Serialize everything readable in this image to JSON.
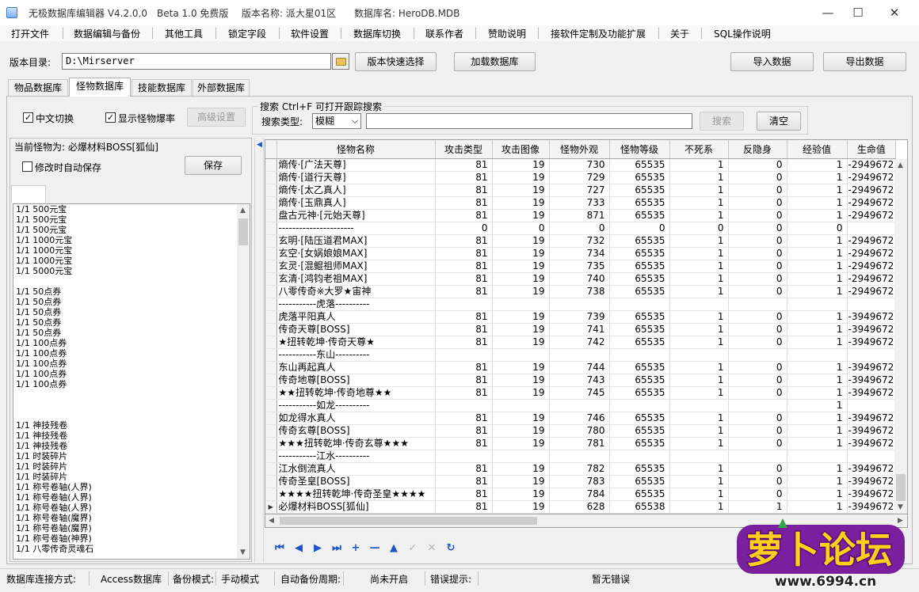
{
  "window": {
    "title": "无极数据库编辑器 V4.2.0.0",
    "beta": "Beta 1.0 免费版",
    "version_name": "版本名称: 派大星01区",
    "db_name": "数据库名: HeroDB.MDB"
  },
  "menu": [
    "打开文件",
    "数据编辑与备份",
    "其他工具",
    "锁定字段",
    "软件设置",
    "数据库切换",
    "联系作者",
    "赞助说明",
    "接软件定制及功能扩展",
    "关于",
    "SQL操作说明"
  ],
  "toolbar": {
    "dir_label": "版本目录:",
    "dir_value": "D:\\Mirserver",
    "quick_select": "版本快速选择",
    "load_db": "加载数据库",
    "import": "导入数据",
    "export": "导出数据"
  },
  "tabs": [
    "物品数据库",
    "怪物数据库",
    "技能数据库",
    "外部数据库"
  ],
  "options": {
    "cn_switch": "中文切换",
    "show_drop": "显示怪物爆率",
    "advanced": "高级设置"
  },
  "search": {
    "group_title": "搜索  Ctrl+F 可打开跟踪搜索",
    "type_label": "搜索类型:",
    "type_value": "模糊",
    "search_btn": "搜索",
    "clear_btn": "清空"
  },
  "left": {
    "current_monster": "当前怪物为: 必爆材料BOSS[狐仙]",
    "autosave": "修改时自动保存",
    "save": "保存",
    "drops": [
      "1/1 500元宝",
      "1/1 500元宝",
      "1/1 500元宝",
      "1/1 1000元宝",
      "1/1 1000元宝",
      "1/1 1000元宝",
      "1/1 5000元宝",
      "",
      "1/1 50点券",
      "1/1 50点券",
      "1/1 50点券",
      "1/1 50点券",
      "1/1 50点券",
      "1/1 100点券",
      "1/1 100点券",
      "1/1 100点券",
      "1/1 100点券",
      "1/1 100点券",
      "",
      "",
      "",
      "1/1 神技残卷",
      "1/1 神技残卷",
      "1/1 神技残卷",
      "1/1 时装碎片",
      "1/1 时装碎片",
      "1/1 时装碎片",
      "1/1 称号卷轴(人界)",
      "1/1 称号卷轴(人界)",
      "1/1 称号卷轴(人界)",
      "1/1 称号卷轴(魔界)",
      "1/1 称号卷轴(魔界)",
      "1/1 称号卷轴(神界)",
      "1/1 八零传奇灵魂石"
    ]
  },
  "grid": {
    "columns": [
      "怪物名称",
      "攻击类型",
      "攻击图像",
      "怪物外观",
      "怪物等级",
      "不死系",
      "反隐身",
      "经验值",
      "生命值"
    ],
    "rows": [
      [
        "熵传·[广法天尊]",
        "81",
        "19",
        "730",
        "65535",
        "1",
        "0",
        "1",
        "-2949672"
      ],
      [
        "熵传·[道行天尊]",
        "81",
        "19",
        "729",
        "65535",
        "1",
        "0",
        "1",
        "-2949672"
      ],
      [
        "熵传·[太乙真人]",
        "81",
        "19",
        "727",
        "65535",
        "1",
        "0",
        "1",
        "-2949672"
      ],
      [
        "熵传·[玉鼎真人]",
        "81",
        "19",
        "733",
        "65535",
        "1",
        "0",
        "1",
        "-2949672"
      ],
      [
        "盘古元神·[元始天尊]",
        "81",
        "19",
        "871",
        "65535",
        "1",
        "0",
        "1",
        "-2949672"
      ],
      [
        "----------------------",
        "0",
        "0",
        "0",
        "0",
        "0",
        "0",
        "0",
        ""
      ],
      [
        "玄明·[陆压道君MAX]",
        "81",
        "19",
        "732",
        "65535",
        "1",
        "0",
        "1",
        "-2949672"
      ],
      [
        "玄空·[女娲娘娘MAX]",
        "81",
        "19",
        "734",
        "65535",
        "1",
        "0",
        "1",
        "-2949672"
      ],
      [
        "玄灵·[混鲲祖师MAX]",
        "81",
        "19",
        "735",
        "65535",
        "1",
        "0",
        "1",
        "-2949672"
      ],
      [
        "玄清·[鸿钧老祖MAX]",
        "81",
        "19",
        "740",
        "65535",
        "1",
        "0",
        "1",
        "-2949672"
      ],
      [
        "八零传奇※大罗★宙神",
        "81",
        "19",
        "738",
        "65535",
        "1",
        "0",
        "1",
        "-2949672"
      ],
      [
        "-----------虎落----------",
        "",
        "",
        "",
        "",
        "",
        "",
        "",
        ""
      ],
      [
        "虎落平阳真人",
        "81",
        "19",
        "739",
        "65535",
        "1",
        "0",
        "1",
        "-3949672"
      ],
      [
        "传奇天尊[BOSS]",
        "81",
        "19",
        "741",
        "65535",
        "1",
        "0",
        "1",
        "-3949672"
      ],
      [
        "★扭转乾坤·传奇天尊★",
        "81",
        "19",
        "742",
        "65535",
        "1",
        "0",
        "1",
        "-3949672"
      ],
      [
        "-----------东山----------",
        "",
        "",
        "",
        "",
        "",
        "",
        "",
        ""
      ],
      [
        "东山再起真人",
        "81",
        "19",
        "744",
        "65535",
        "1",
        "0",
        "1",
        "-3949672"
      ],
      [
        "传奇地尊[BOSS]",
        "81",
        "19",
        "743",
        "65535",
        "1",
        "0",
        "1",
        "-3949672"
      ],
      [
        "★★扭转乾坤·传奇地尊★★",
        "81",
        "19",
        "745",
        "65535",
        "1",
        "0",
        "1",
        "-3949672"
      ],
      [
        "-----------如龙----------",
        "",
        "",
        "",
        "",
        "",
        "",
        "1",
        ""
      ],
      [
        "如龙得水真人",
        "81",
        "19",
        "746",
        "65535",
        "1",
        "0",
        "1",
        "-3949672"
      ],
      [
        "传奇玄尊[BOSS]",
        "81",
        "19",
        "780",
        "65535",
        "1",
        "0",
        "1",
        "-3949672"
      ],
      [
        "★★★扭转乾坤·传奇玄尊★★★",
        "81",
        "19",
        "781",
        "65535",
        "1",
        "0",
        "1",
        "-3949672"
      ],
      [
        "-----------江水----------",
        "",
        "",
        "",
        "",
        "",
        "",
        "",
        ""
      ],
      [
        "江水倒流真人",
        "81",
        "19",
        "782",
        "65535",
        "1",
        "0",
        "1",
        "-3949672"
      ],
      [
        "传奇圣皇[BOSS]",
        "81",
        "19",
        "783",
        "65535",
        "1",
        "0",
        "1",
        "-3949672"
      ],
      [
        "★★★★扭转乾坤·传奇圣皇★★★★",
        "81",
        "19",
        "784",
        "65535",
        "1",
        "0",
        "1",
        "-3949672"
      ],
      [
        "必爆材料BOSS[狐仙]",
        "81",
        "19",
        "628",
        "65538",
        "1",
        "1",
        "1",
        "-3949672"
      ]
    ]
  },
  "status": {
    "conn_label": "数据库连接方式:",
    "conn_value": "Access数据库",
    "backup_label": "备份模式:",
    "backup_value": "手动模式",
    "auto_label": "自动备份周期:",
    "auto_value": "尚未开启",
    "error_label": "错误提示:",
    "error_value": "暂无错误"
  },
  "logo": {
    "text": "萝卜论坛",
    "url": "www.6994.cn"
  },
  "colors": {
    "nav_blue": "#1e56c8",
    "logo_yellow": "#ffcf1a",
    "logo_purple": "#7a1f9e"
  }
}
